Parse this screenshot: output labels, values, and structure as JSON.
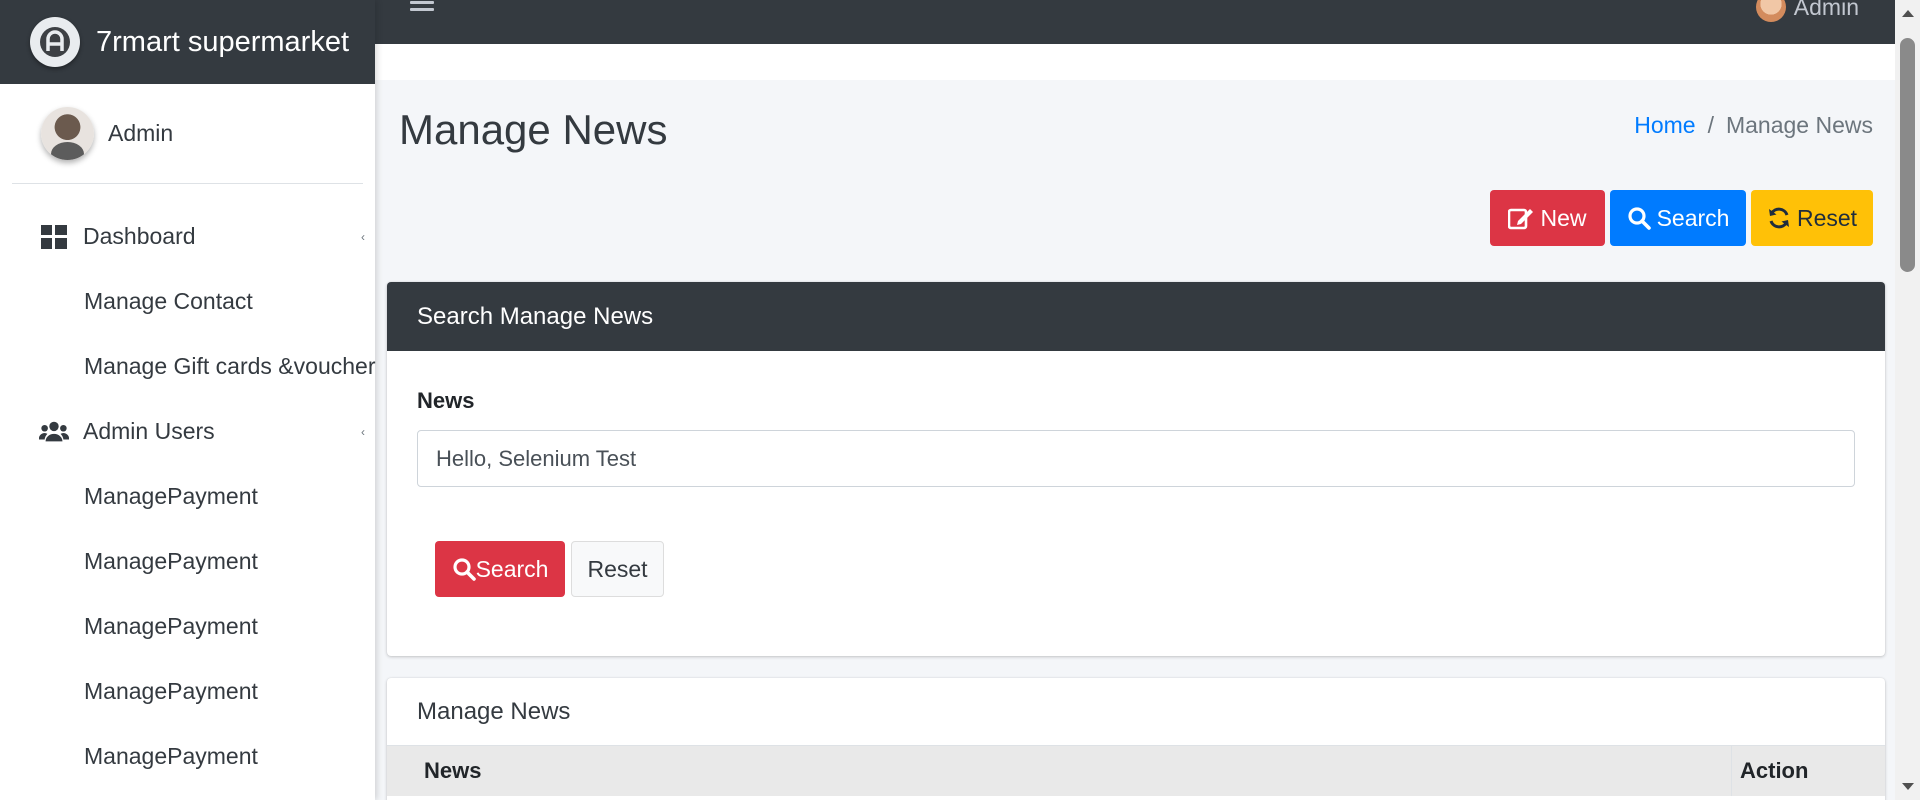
{
  "brand": {
    "name": "7rmart supermarket",
    "logo_icon": "brand-logo-icon"
  },
  "user_panel": {
    "name": "Admin"
  },
  "sidebar": {
    "items": [
      {
        "label": "Dashboard",
        "icon": "dashboard-grid-icon",
        "has_caret": true
      },
      {
        "label": "Manage Contact",
        "sub": true
      },
      {
        "label": "Manage Gift cards &voucher",
        "sub": true
      },
      {
        "label": "Admin Users",
        "icon": "users-icon",
        "has_caret": true
      },
      {
        "label": "ManagePayment",
        "sub": true
      },
      {
        "label": "ManagePayment",
        "sub": true
      },
      {
        "label": "ManagePayment",
        "sub": true
      },
      {
        "label": "ManagePayment",
        "sub": true
      },
      {
        "label": "ManagePayment",
        "sub": true
      }
    ]
  },
  "topbar": {
    "user_name": "Admin"
  },
  "page": {
    "title": "Manage News"
  },
  "breadcrumb": {
    "home": "Home",
    "separator": "/",
    "current": "Manage News"
  },
  "actions": {
    "new_label": "New",
    "search_label": "Search",
    "reset_label": "Reset"
  },
  "search_card": {
    "header": "Search Manage News",
    "field_label": "News",
    "field_value": "Hello, Selenium Test",
    "search_button": "Search",
    "reset_button": "Reset"
  },
  "list_card": {
    "title": "Manage News",
    "columns": [
      "News",
      "Action"
    ]
  },
  "colors": {
    "danger": "#dc3545",
    "primary": "#007bff",
    "warning": "#ffc107",
    "dark": "#343a40",
    "link": "#007bff"
  }
}
